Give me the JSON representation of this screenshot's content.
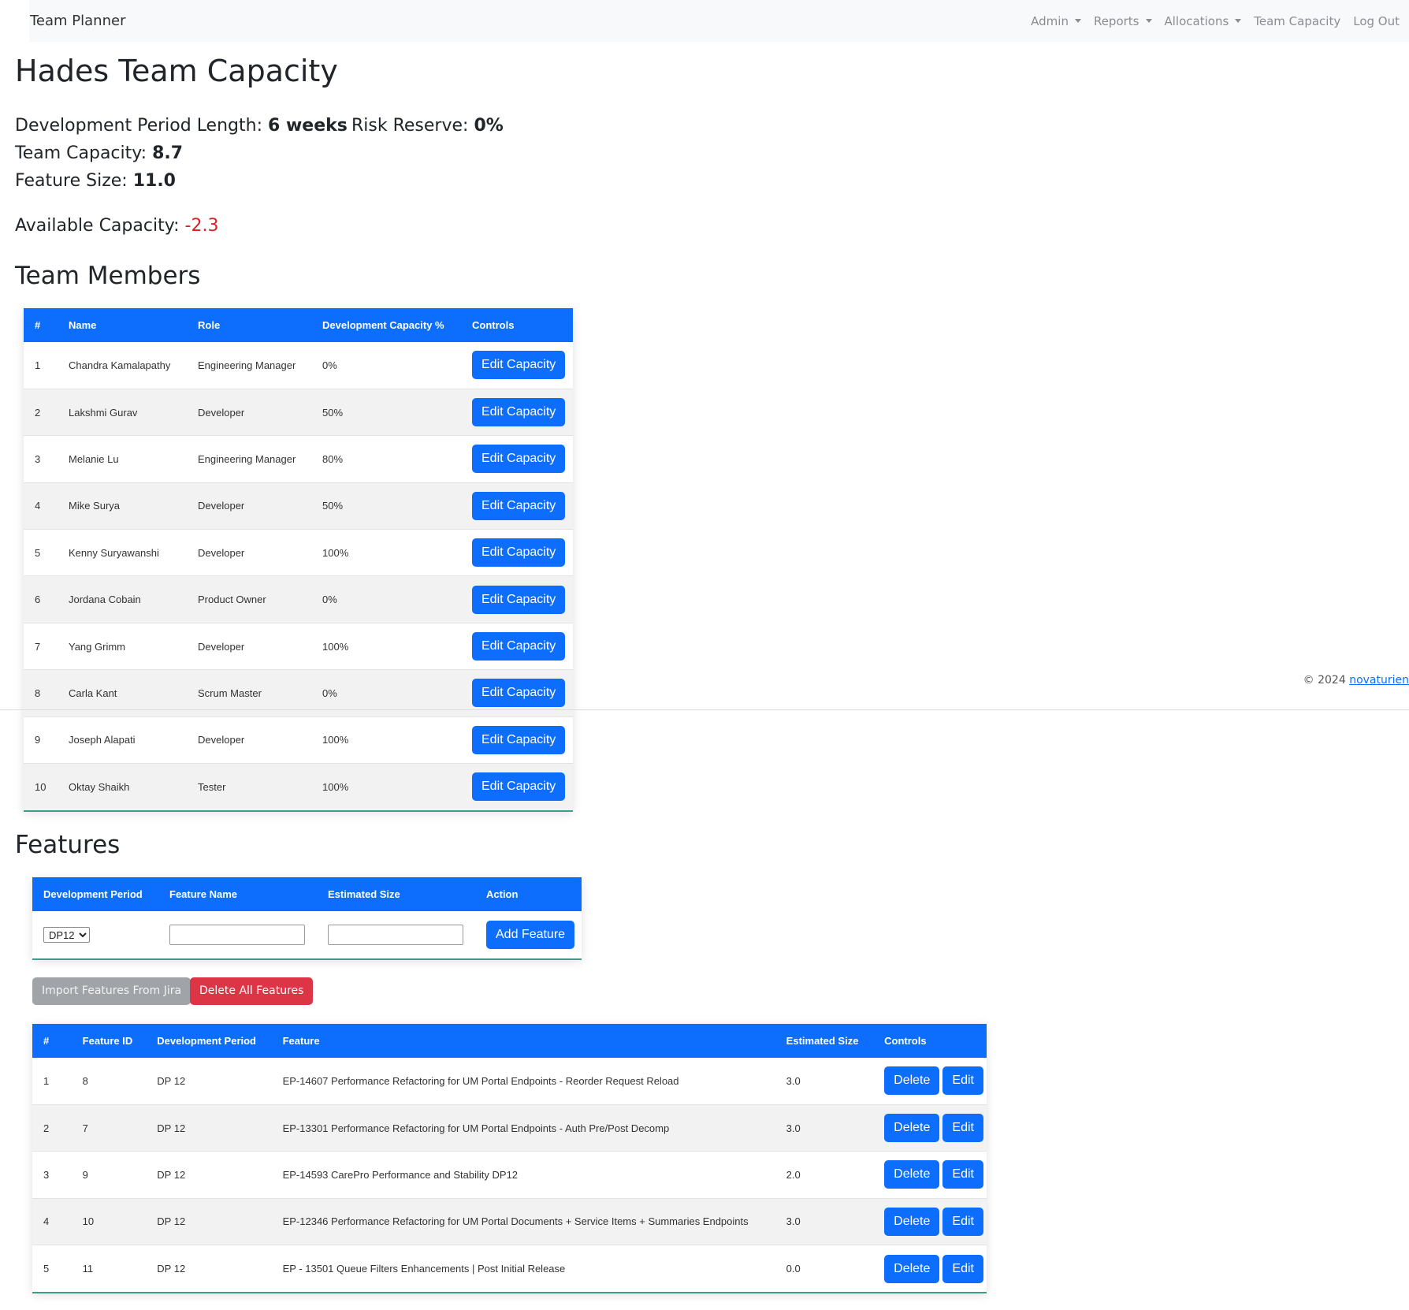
{
  "navbar": {
    "brand": "Team Planner",
    "items": [
      {
        "label": "Admin",
        "dropdown": true
      },
      {
        "label": "Reports",
        "dropdown": true
      },
      {
        "label": "Allocations",
        "dropdown": true
      },
      {
        "label": "Team Capacity",
        "dropdown": false
      },
      {
        "label": "Log Out",
        "dropdown": false
      }
    ]
  },
  "page": {
    "title": "Hades Team Capacity",
    "dev_period_label": "Development Period Length: ",
    "dev_period_value": "6 weeks",
    "risk_reserve_label": "Risk Reserve: ",
    "risk_reserve_value": "0%",
    "team_capacity_label": "Team Capacity: ",
    "team_capacity_value": "8.7",
    "feature_size_label": "Feature Size: ",
    "feature_size_value": "11.0",
    "available_capacity_label": "Available Capacity: ",
    "available_capacity_value": "-2.3",
    "negative_color": "#dc1f26"
  },
  "team_members": {
    "heading": "Team Members",
    "columns": [
      "#",
      "Name",
      "Role",
      "Development Capacity %",
      "Controls"
    ],
    "button_label": "Edit Capacity",
    "rows": [
      {
        "num": "1",
        "name": "Chandra Kamalapathy",
        "role": "Engineering Manager",
        "capacity": "0%"
      },
      {
        "num": "2",
        "name": "Lakshmi Gurav",
        "role": "Developer",
        "capacity": "50%"
      },
      {
        "num": "3",
        "name": "Melanie Lu",
        "role": "Engineering Manager",
        "capacity": "80%"
      },
      {
        "num": "4",
        "name": "Mike Surya",
        "role": "Developer",
        "capacity": "50%"
      },
      {
        "num": "5",
        "name": "Kenny Suryawanshi",
        "role": "Developer",
        "capacity": "100%"
      },
      {
        "num": "6",
        "name": "Jordana Cobain",
        "role": "Product Owner",
        "capacity": "0%"
      },
      {
        "num": "7",
        "name": "Yang Grimm",
        "role": "Developer",
        "capacity": "100%"
      },
      {
        "num": "8",
        "name": "Carla Kant",
        "role": "Scrum Master",
        "capacity": "0%"
      },
      {
        "num": "9",
        "name": "Joseph Alapati",
        "role": "Developer",
        "capacity": "100%"
      },
      {
        "num": "10",
        "name": "Oktay Shaikh",
        "role": "Tester",
        "capacity": "100%"
      }
    ]
  },
  "features": {
    "heading": "Features",
    "add_form": {
      "columns": [
        "Development Period",
        "Feature Name",
        "Estimated Size",
        "Action"
      ],
      "period_selected": "DP12",
      "feature_name_value": "",
      "estimated_size_value": "",
      "add_button": "Add Feature"
    },
    "import_button": "Import Features From Jira",
    "delete_all_button": "Delete All Features",
    "columns": [
      "#",
      "Feature ID",
      "Development Period",
      "Feature",
      "Estimated Size",
      "Controls"
    ],
    "delete_label": "Delete",
    "edit_label": "Edit",
    "rows": [
      {
        "num": "1",
        "id": "8",
        "period": "DP 12",
        "feature": "EP-14607 Performance Refactoring for UM Portal Endpoints - Reorder Request Reload",
        "size": "3.0"
      },
      {
        "num": "2",
        "id": "7",
        "period": "DP 12",
        "feature": "EP-13301 Performance Refactoring for UM Portal Endpoints - Auth Pre/Post Decomp",
        "size": "3.0"
      },
      {
        "num": "3",
        "id": "9",
        "period": "DP 12",
        "feature": "EP-14593 CarePro Performance and Stability DP12",
        "size": "2.0"
      },
      {
        "num": "4",
        "id": "10",
        "period": "DP 12",
        "feature": "EP-12346 Performance Refactoring for UM Portal Documents + Service Items + Summaries Endpoints",
        "size": "3.0"
      },
      {
        "num": "5",
        "id": "11",
        "period": "DP 12",
        "feature": "EP - 13501 Queue Filters Enhancements | Post Initial Release",
        "size": "0.0"
      }
    ]
  },
  "footer": {
    "copyright": "© 2024 ",
    "link": "novaturien"
  }
}
